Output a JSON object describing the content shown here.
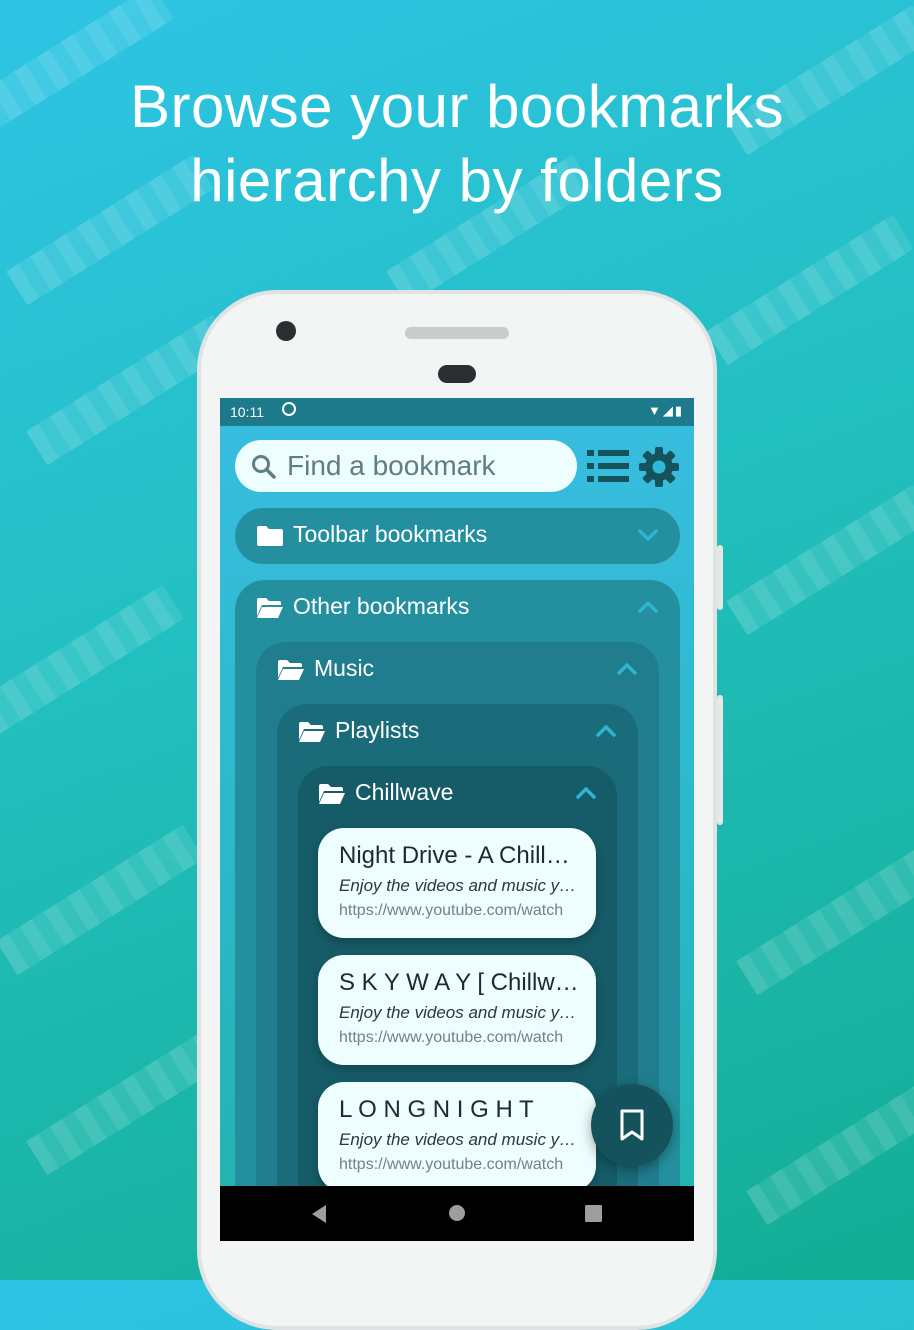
{
  "headline": {
    "line1": "Browse your bookmarks",
    "line2": "hierarchy by folders"
  },
  "statusbar": {
    "time": "10:11",
    "icons": [
      "sync-icon",
      "wifi-icon",
      "signal-icon",
      "battery-icon"
    ]
  },
  "search": {
    "placeholder": "Find a bookmark",
    "icon": "search-icon"
  },
  "toolbar": {
    "list_icon": "list-icon",
    "settings_icon": "gear-icon"
  },
  "folders": {
    "toolbar": {
      "label": "Toolbar bookmarks",
      "expanded": false
    },
    "other": {
      "label": "Other bookmarks",
      "expanded": true
    },
    "music": {
      "label": "Music",
      "expanded": true
    },
    "playlists": {
      "label": "Playlists",
      "expanded": true
    },
    "chillwave": {
      "label": "Chillwave",
      "expanded": true
    }
  },
  "bookmarks": [
    {
      "title": "Night Drive - A Chillwave Mix",
      "description": "Enjoy the videos and music you love",
      "url": "https://www.youtube.com/watch"
    },
    {
      "title": "S K Y W A Y [ Chillwave Mix ]",
      "description": "Enjoy the videos and music you love",
      "url": "https://www.youtube.com/watch"
    },
    {
      "title": "L O N G N I G H T",
      "description": "Enjoy the videos and music you love",
      "url": "https://www.youtube.com/watch"
    }
  ],
  "fab": {
    "icon": "bookmark-icon"
  },
  "navbar": {
    "icons": [
      "back-icon",
      "home-icon",
      "recents-icon"
    ]
  },
  "colors": {
    "accent": "#2ab8c6",
    "dark_teal": "#15535c",
    "card_bg": "#eefdfd",
    "chevron": "#2fb5d0"
  }
}
